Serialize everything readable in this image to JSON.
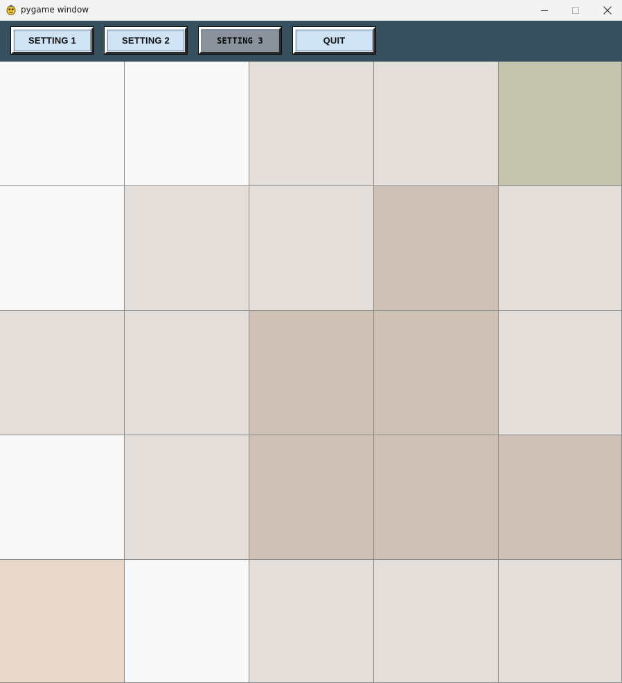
{
  "window": {
    "title": "pygame window",
    "icon": "pygame-snake-icon",
    "controls": [
      "minimize-icon",
      "maximize-icon",
      "close-icon"
    ]
  },
  "toolbar": {
    "background": "#354f5d",
    "buttons": [
      {
        "label": "SETTING 1",
        "active": false
      },
      {
        "label": "SETTING 2",
        "active": false
      },
      {
        "label": "SETTING 3",
        "active": true
      },
      {
        "label": "QUIT",
        "active": false
      }
    ]
  },
  "board": {
    "rows": 5,
    "cols": 5,
    "palette": {
      "W": "#f8f8f8",
      "L": "#e4dfda",
      "T": "#cdc1b6",
      "G": "#c3c4ae",
      "P": "#e9d7ca"
    },
    "cells": [
      [
        "W",
        "W",
        "L",
        "L",
        "G"
      ],
      [
        "W",
        "L",
        "L",
        "T",
        "L"
      ],
      [
        "L",
        "L",
        "T",
        "T",
        "L"
      ],
      [
        "W",
        "L",
        "T",
        "T",
        "T"
      ],
      [
        "P",
        "W",
        "L",
        "L",
        "L"
      ]
    ]
  }
}
